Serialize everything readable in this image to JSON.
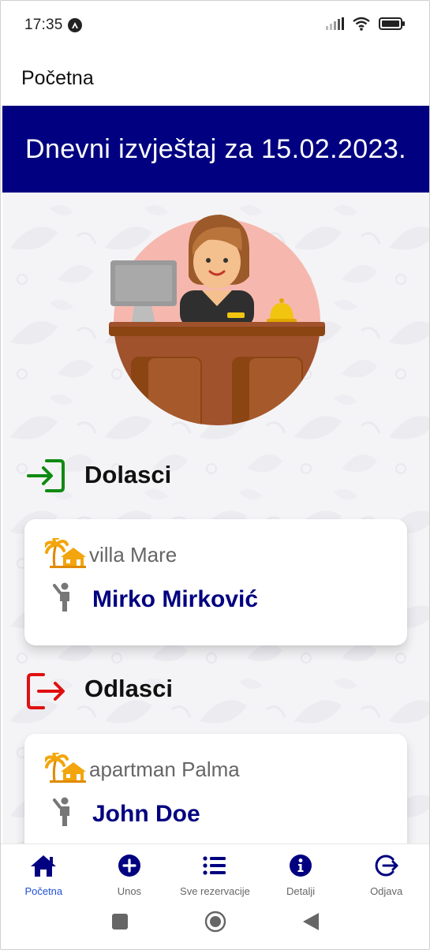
{
  "status_bar": {
    "time": "17:35"
  },
  "app_bar": {
    "title": "Početna"
  },
  "report": {
    "title": "Dnevni izvještaj za 15.02.2023."
  },
  "colors": {
    "primary": "#000080",
    "active_nav": "#1e4fd8",
    "arrivals_icon": "#0f8a12",
    "departures_icon": "#e01010",
    "villa_icon": "#f2a50c"
  },
  "arrivals": {
    "title": "Dolasci",
    "items": [
      {
        "property": "villa Mare",
        "guest": "Mirko Mirković"
      }
    ]
  },
  "departures": {
    "title": "Odlasci",
    "items": [
      {
        "property": "apartman Palma",
        "guest": "John Doe"
      }
    ]
  },
  "bottom_nav": {
    "items": [
      {
        "label": "Početna",
        "icon": "home-icon",
        "active": true
      },
      {
        "label": "Unos",
        "icon": "plus-circle-icon",
        "active": false
      },
      {
        "label": "Sve rezervacije",
        "icon": "list-icon",
        "active": false
      },
      {
        "label": "Detalji",
        "icon": "info-icon",
        "active": false
      },
      {
        "label": "Odjava",
        "icon": "logout-icon",
        "active": false
      }
    ]
  }
}
